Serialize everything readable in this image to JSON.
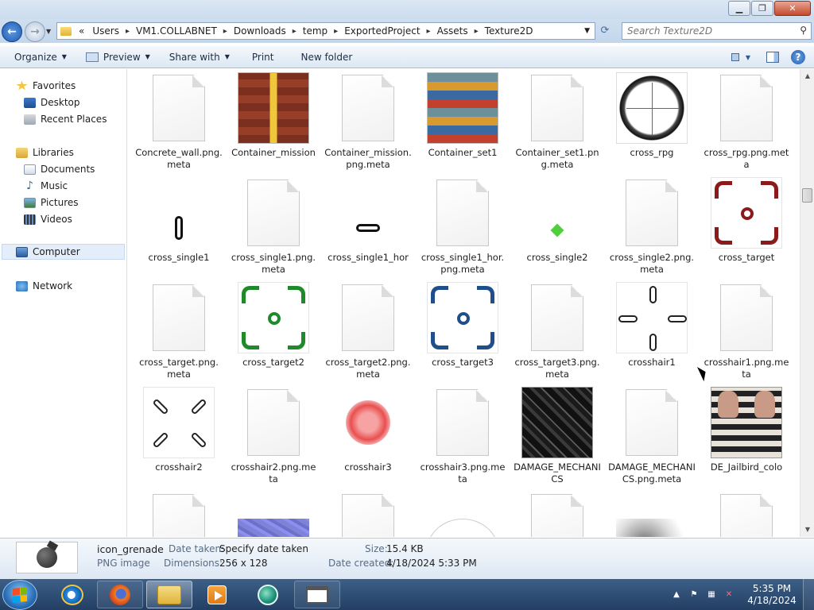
{
  "window": {
    "minimize": "▁",
    "maximize": "❐",
    "close": "✕"
  },
  "address": {
    "overflow": "«",
    "crumbs": [
      "Users",
      "VM1.COLLABNET",
      "Downloads",
      "temp",
      "ExportedProject",
      "Assets",
      "Texture2D"
    ]
  },
  "search": {
    "placeholder": "Search Texture2D"
  },
  "toolbar": {
    "organize": "Organize",
    "preview": "Preview",
    "share_with": "Share with",
    "print": "Print",
    "new_folder": "New folder"
  },
  "nav": {
    "favorites": "Favorites",
    "desktop": "Desktop",
    "recent_places": "Recent Places",
    "libraries": "Libraries",
    "documents": "Documents",
    "music": "Music",
    "pictures": "Pictures",
    "videos": "Videos",
    "computer": "Computer",
    "network": "Network"
  },
  "files": [
    {
      "name": "Concrete_wall.png.meta",
      "thumb": "doc"
    },
    {
      "name": "Container_mission",
      "thumb": "container-mission"
    },
    {
      "name": "Container_mission.png.meta",
      "thumb": "doc"
    },
    {
      "name": "Container_set1",
      "thumb": "container-set"
    },
    {
      "name": "Container_set1.png.meta",
      "thumb": "doc"
    },
    {
      "name": "cross_rpg",
      "thumb": "scope"
    },
    {
      "name": "cross_rpg.png.meta",
      "thumb": "doc"
    },
    {
      "name": "cross_single1",
      "thumb": "vpill"
    },
    {
      "name": "cross_single1.png.meta",
      "thumb": "doc"
    },
    {
      "name": "cross_single1_hor",
      "thumb": "hpill"
    },
    {
      "name": "cross_single1_hor.png.meta",
      "thumb": "doc"
    },
    {
      "name": "cross_single2",
      "thumb": "diamond"
    },
    {
      "name": "cross_single2.png.meta",
      "thumb": "doc"
    },
    {
      "name": "cross_target",
      "thumb": "target-red"
    },
    {
      "name": "cross_target.png.meta",
      "thumb": "doc"
    },
    {
      "name": "cross_target2",
      "thumb": "target-green"
    },
    {
      "name": "cross_target2.png.meta",
      "thumb": "doc"
    },
    {
      "name": "cross_target3",
      "thumb": "target-blue"
    },
    {
      "name": "cross_target3.png.meta",
      "thumb": "doc"
    },
    {
      "name": "crosshair1",
      "thumb": "crosshair1"
    },
    {
      "name": "crosshair1.png.meta",
      "thumb": "doc"
    },
    {
      "name": "crosshair2",
      "thumb": "crosshair2"
    },
    {
      "name": "crosshair2.png.meta",
      "thumb": "doc"
    },
    {
      "name": "crosshair3",
      "thumb": "glow"
    },
    {
      "name": "crosshair3.png.meta",
      "thumb": "doc"
    },
    {
      "name": "DAMAGE_MECHANICS",
      "thumb": "damage"
    },
    {
      "name": "DAMAGE_MECHANICS.png.meta",
      "thumb": "doc"
    },
    {
      "name": "DE_Jailbird_colo",
      "thumb": "jail"
    },
    {
      "name": "",
      "thumb": "doc"
    },
    {
      "name": "",
      "thumb": "normal"
    },
    {
      "name": "",
      "thumb": "doc"
    },
    {
      "name": "",
      "thumb": "circle"
    },
    {
      "name": "",
      "thumb": "doc"
    },
    {
      "name": "",
      "thumb": "smoke"
    },
    {
      "name": "",
      "thumb": "doc"
    }
  ],
  "colors": {
    "target_red": "#8b1a1a",
    "target_green": "#1f8a2a",
    "target_blue": "#1f4f8a",
    "accent": "#3b6fb0"
  },
  "details": {
    "name": "icon_grenade",
    "type": "PNG image",
    "date_taken_label": "Date taken:",
    "date_taken_value": "Specify date taken",
    "dimensions_label": "Dimensions:",
    "dimensions_value": "256 x 128",
    "size_label": "Size:",
    "size_value": "15.4 KB",
    "date_created_label": "Date created:",
    "date_created_value": "4/18/2024 5:33 PM"
  },
  "taskbar": {
    "apps": [
      "internet-explorer-icon",
      "firefox-icon",
      "windows-explorer-icon",
      "media-player-icon",
      "wireshark-icon",
      "window-app-icon"
    ],
    "time": "5:35 PM",
    "date": "4/18/2024"
  }
}
